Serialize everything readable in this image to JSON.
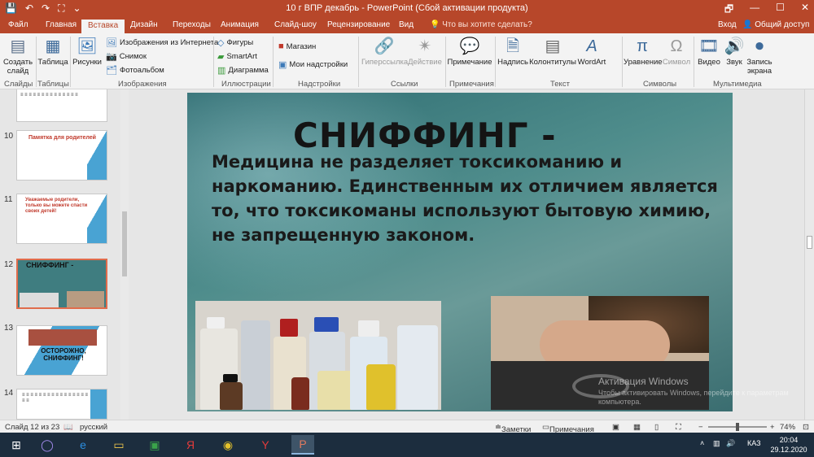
{
  "window": {
    "title": "10 г ВПР декабрь - PowerPoint (Сбой активации продукта)",
    "qat_save": "💾",
    "qat_undo": "↶",
    "qat_redo": "↷",
    "qat_present": "⛶",
    "qat_more": "⌄",
    "win_restore": "🗗",
    "win_minimize": "—",
    "win_maximize": "☐",
    "win_close": "✕"
  },
  "tabs": [
    {
      "label": "Файл"
    },
    {
      "label": "Главная"
    },
    {
      "label": "Вставка"
    },
    {
      "label": "Дизайн"
    },
    {
      "label": "Переходы"
    },
    {
      "label": "Анимация"
    },
    {
      "label": "Слайд-шоу"
    },
    {
      "label": "Рецензирование"
    },
    {
      "label": "Вид"
    }
  ],
  "tellme": "Что вы хотите сделать?",
  "login": "Вход",
  "share": "Общий доступ",
  "ribbon": {
    "new_slide": "Создать слайд",
    "table": "Таблица",
    "pictures": "Рисунки",
    "online_pictures": "Изображения из Интернета",
    "screenshot": "Снимок",
    "photo_album": "Фотоальбом",
    "shapes": "Фигуры",
    "smartart": "SmartArt",
    "chart": "Диаграмма",
    "store": "Магазин",
    "my_addins": "Мои надстройки",
    "hyperlink": "Гиперссылка",
    "action": "Действие",
    "comment": "Примечание",
    "textbox": "Надпись",
    "header_footer": "Колонтитулы",
    "wordart": "WordArt",
    "equation": "Уравнение",
    "symbol": "Символ",
    "video": "Видео",
    "audio": "Звук",
    "screen_recording": "Запись экрана",
    "groups": {
      "slides": "Слайды",
      "tables": "Таблицы",
      "images": "Изображения",
      "illustrations": "Иллюстрации",
      "addins": "Надстройки",
      "links": "Ссылки",
      "comments": "Примечания",
      "text": "Текст",
      "symbols": "Символы",
      "media": "Мультимедиа"
    }
  },
  "thumbnails": [
    {
      "num": "10",
      "title": "Памятка для родителей"
    },
    {
      "num": "11",
      "title": "Уважаемые родители, только вы можете спасти своих детей!"
    },
    {
      "num": "12",
      "title": "СНИФФИНГ -"
    },
    {
      "num": "13",
      "title": "ОСТОРОЖНО, СНИФФИНГ!"
    },
    {
      "num": "14",
      "title": ""
    }
  ],
  "slide": {
    "title": "СНИФФИНГ -",
    "body": "Медицина не разделяет токсикоманию и наркоманию. Единственным их отличием является то, что токсикоманы используют бытовую химию, не запрещенную законом."
  },
  "watermark": {
    "line1": "Активация Windows",
    "line2": "Чтобы активировать Windows, перейдите к параметрам компьютера."
  },
  "status": {
    "slide_info": "Слайд 12 из 23",
    "language": "русский",
    "notes": "Заметки",
    "comments": "Примечания",
    "zoom": "74%"
  },
  "taskbar": {
    "lang": "КАЗ",
    "time": "20:04",
    "date": "29.12.2020"
  }
}
